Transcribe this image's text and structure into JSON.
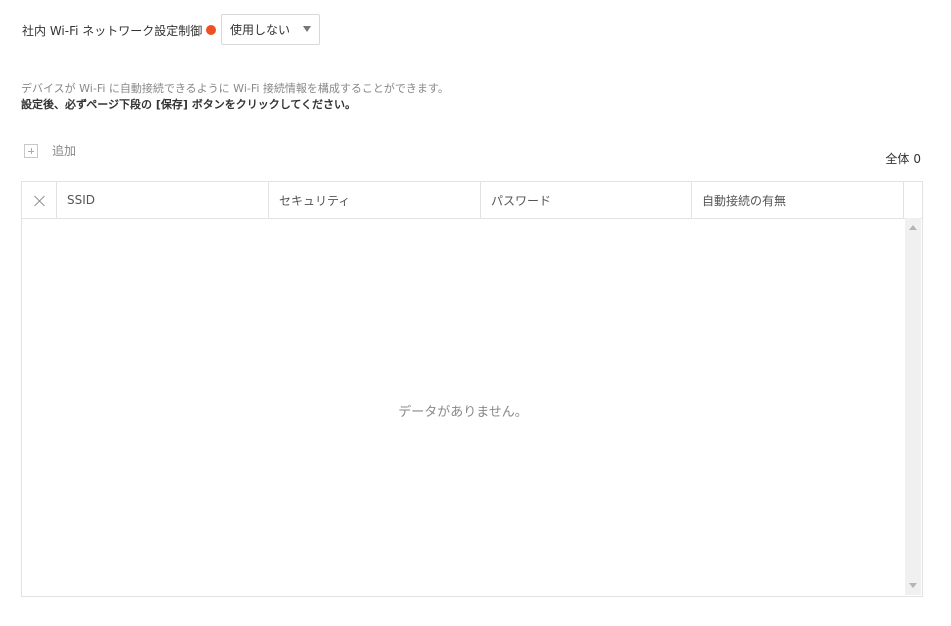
{
  "setting": {
    "label": "社内 Wi-Fi ネットワーク設定制御",
    "required_color": "#f04e23",
    "select_value": "使用しない"
  },
  "description": {
    "line1": "デバイスが Wi-Fi に自動接続できるように Wi-Fi 接続情報を構成することができます。",
    "line2": "設定後、必ずページ下段の [保存] ボタンをクリックしてください。"
  },
  "toolbar": {
    "add_label": "追加",
    "total_label": "全体",
    "total_count": "0"
  },
  "table": {
    "columns": [
      "SSID",
      "セキュリティ",
      "パスワード",
      "自動接続の有無"
    ],
    "empty_message": "データがありません。"
  },
  "icons": [
    "close-icon",
    "plus-icon",
    "chevron-down-icon",
    "scroll-up-icon",
    "scroll-down-icon"
  ]
}
